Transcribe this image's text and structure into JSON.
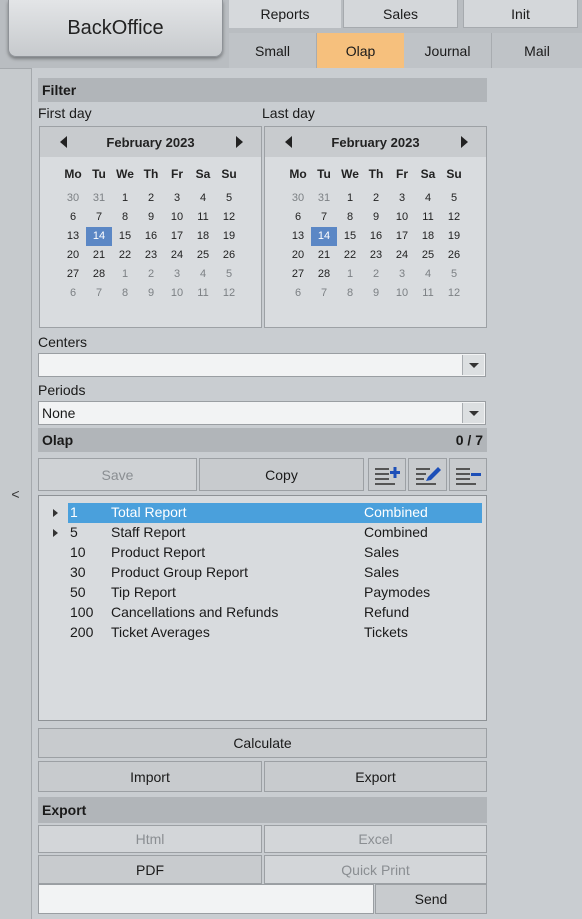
{
  "app": {
    "title": "BackOffice"
  },
  "tabs_top": [
    "Reports",
    "Sales",
    "Init"
  ],
  "tabs_sub": [
    "Small",
    "Olap",
    "Journal",
    "Mail"
  ],
  "collapse_label": "<",
  "filter": {
    "header": "Filter",
    "first_day_label": "First day",
    "last_day_label": "Last day",
    "first_calendar": {
      "month": "February 2023"
    },
    "last_calendar": {
      "month": "February 2023"
    },
    "weekdays": [
      "Mo",
      "Tu",
      "We",
      "Th",
      "Fr",
      "Sa",
      "Su"
    ],
    "days": [
      [
        "30",
        "31",
        "1",
        "2",
        "3",
        "4",
        "5"
      ],
      [
        "6",
        "7",
        "8",
        "9",
        "10",
        "11",
        "12"
      ],
      [
        "13",
        "14",
        "15",
        "16",
        "17",
        "18",
        "19"
      ],
      [
        "20",
        "21",
        "22",
        "23",
        "24",
        "25",
        "26"
      ],
      [
        "27",
        "28",
        "1",
        "2",
        "3",
        "4",
        "5"
      ],
      [
        "6",
        "7",
        "8",
        "9",
        "10",
        "11",
        "12"
      ]
    ],
    "selected_day": "14",
    "centers_label": "Centers",
    "centers_value": "",
    "periods_label": "Periods",
    "periods_value": "None"
  },
  "olap": {
    "header": "Olap",
    "counter": "0 / 7",
    "save_label": "Save",
    "copy_label": "Copy",
    "rows": [
      {
        "id": "1",
        "name": "Total Report",
        "type": "Combined",
        "expandable": true,
        "selected": true
      },
      {
        "id": "5",
        "name": "Staff Report",
        "type": "Combined",
        "expandable": true,
        "selected": false
      },
      {
        "id": "10",
        "name": "Product Report",
        "type": "Sales",
        "expandable": false,
        "selected": false
      },
      {
        "id": "30",
        "name": "Product Group Report",
        "type": "Sales",
        "expandable": false,
        "selected": false
      },
      {
        "id": "50",
        "name": "Tip Report",
        "type": "Paymodes",
        "expandable": false,
        "selected": false
      },
      {
        "id": "100",
        "name": "Cancellations and Refunds",
        "type": "Refund",
        "expandable": false,
        "selected": false
      },
      {
        "id": "200",
        "name": "Ticket Averages",
        "type": "Tickets",
        "expandable": false,
        "selected": false
      }
    ],
    "calculate_label": "Calculate",
    "import_label": "Import",
    "export_label": "Export"
  },
  "export": {
    "header": "Export",
    "html_label": "Html",
    "excel_label": "Excel",
    "pdf_label": "PDF",
    "quick_print_label": "Quick Print",
    "email_value": "",
    "send_label": "Send"
  },
  "colors": {
    "active_tab": "#f6c07d",
    "selection": "#4aa0dc",
    "calendar_selection": "#5b87c5",
    "icon_blue": "#1d4fb8"
  },
  "icons": [
    "add-list-icon",
    "edit-list-icon",
    "remove-list-icon"
  ]
}
